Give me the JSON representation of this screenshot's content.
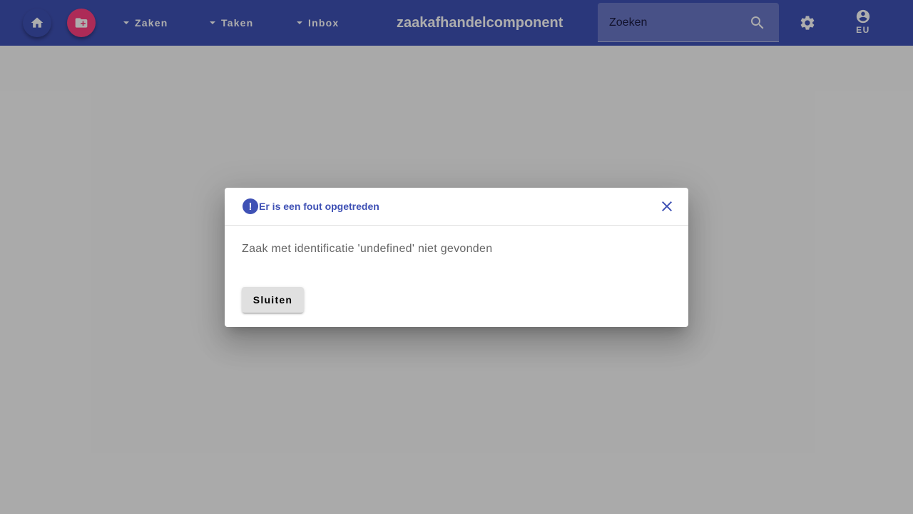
{
  "toolbar": {
    "icons": {
      "home": "home-icon",
      "new_case": "folder-add-icon",
      "settings": "gear-icon",
      "account": "account-circle-icon",
      "search": "search-icon"
    },
    "nav_menus": [
      {
        "label": "Zaken"
      },
      {
        "label": "Taken"
      },
      {
        "label": "Inbox"
      }
    ],
    "app_title": "zaakafhandelcomponent",
    "search": {
      "placeholder": "Zoeken",
      "value": ""
    },
    "user_initials": "EU"
  },
  "dialog": {
    "icon": "error-icon",
    "icon_glyph": "!",
    "title": "Er is een fout opgetreden",
    "message": "Zaak met identificatie 'undefined' niet gevonden",
    "close_label": "Sluiten"
  },
  "colors": {
    "primary": "#3f51b5",
    "accent": "#ff4081",
    "backdrop": "rgba(0,0,0,0.32)"
  }
}
